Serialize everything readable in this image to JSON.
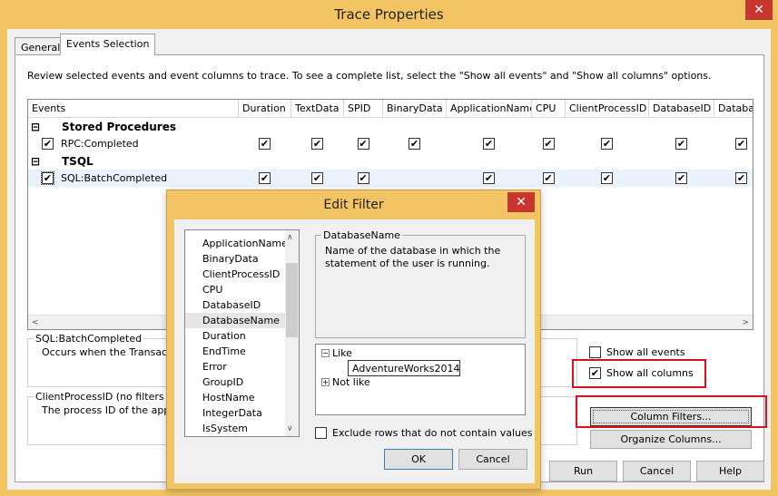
{
  "window": {
    "title": "Trace Properties",
    "close_glyph": "✕",
    "tabs": [
      {
        "label": "General"
      },
      {
        "label": "Events Selection"
      }
    ],
    "intro": "Review selected events and event columns to trace. To see a complete list, select the \"Show all events\" and \"Show all columns\" options."
  },
  "grid": {
    "headers": [
      "Events",
      "Duration",
      "TextData",
      "SPID",
      "BinaryData",
      "ApplicationName",
      "CPU",
      "ClientProcessID",
      "DatabaseID",
      "Databas"
    ],
    "groups": [
      {
        "expander": "⊟",
        "label": "Stored Procedures",
        "event": "RPC:Completed"
      },
      {
        "expander": "⊟",
        "label": "TSQL",
        "event": "SQL:BatchCompleted"
      }
    ],
    "check_glyph": "✔",
    "scroll_left": "<",
    "scroll_right": ">"
  },
  "event_info": {
    "legend": "SQL:BatchCompleted",
    "description": "Occurs when the Transact-S"
  },
  "column_info": {
    "legend": "ClientProcessID (no filters appli",
    "description": "The process ID of the applica"
  },
  "options": {
    "show_all_events": "Show all events",
    "show_all_columns": "Show all columns"
  },
  "buttons": {
    "column_filters": "Column Filters...",
    "organize_columns": "Organize Columns...",
    "run": "Run",
    "cancel": "Cancel",
    "help": "Help"
  },
  "edit_filter": {
    "title": "Edit Filter",
    "close_glyph": "✕",
    "columns": [
      "ApplicationName",
      "BinaryData",
      "ClientProcessID",
      "CPU",
      "DatabaseID",
      "DatabaseName",
      "Duration",
      "EndTime",
      "Error",
      "GroupID",
      "HostName",
      "IntegerData",
      "IsSystem"
    ],
    "selected_column": "DatabaseName",
    "desc_legend": "DatabaseName",
    "desc_text": "Name of the database in which the statement of the user is running.",
    "tree": {
      "like_label": "Like",
      "like_value": "AdventureWorks2014",
      "not_like_label": "Not like",
      "minus": "−",
      "plus": "+"
    },
    "exclude_label": "Exclude rows that do not contain values",
    "ok": "OK",
    "cancel": "Cancel",
    "scroll_up": "∧",
    "scroll_down": "∨"
  }
}
